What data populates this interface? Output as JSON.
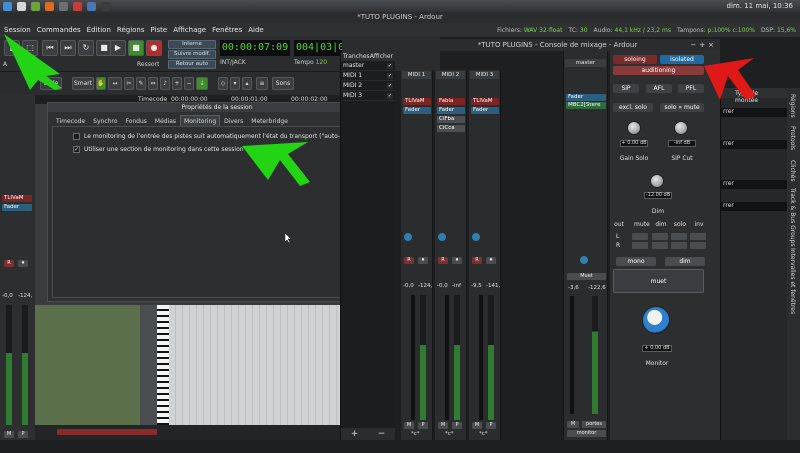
{
  "system": {
    "clock": "dim. 11 mai, 10:36"
  },
  "main_window": {
    "title": "*TUTO PLUGINS - Ardour"
  },
  "menubar": {
    "items": [
      "Session",
      "Commandes",
      "Édition",
      "Régions",
      "Piste",
      "Affichage",
      "Fenêtres",
      "Aide"
    ],
    "status": {
      "files_label": "Fichiers:",
      "files_value": "WAV 32-float",
      "tc_label": "TC:",
      "tc_value": "30",
      "audio_label": "Audio:",
      "audio_value": "44,1 kHz / 23,2 ms",
      "buffers_label": "Tampons:",
      "buffers_value": "p:100% c:100%",
      "dsp_label": "DSP:",
      "dsp_value": "15,6%"
    }
  },
  "transport": {
    "sync_buttons": [
      "Interne",
      "Suivre modif.",
      "Retour auto"
    ],
    "clock_primary": "00:00:07:09",
    "clock_secondary": "004|03|0",
    "source": "INT/JACK",
    "tempo_label": "Tempo",
    "tempo_value": "120",
    "auto_label": "A",
    "ressort_label": "Ressort"
  },
  "toolbar": {
    "slide": "Slide",
    "smart": "Smart",
    "sons": "Sons"
  },
  "timeline": {
    "timecode_label": "Timecode",
    "times": [
      "00:00:00:00",
      "00:00:01:00",
      "00:00:02:00"
    ]
  },
  "dialog": {
    "title": "Propriétés de la session",
    "tabs": [
      "Timecode",
      "Synchro",
      "Fondus",
      "Médias",
      "Monitoring",
      "Divers",
      "Meterbridge"
    ],
    "active_tab": "Monitoring",
    "options": [
      {
        "label": "Le monitoring de l'entrée des pistes suit automatiquement l'état du transport (\"auto-input\")",
        "checked": false
      },
      {
        "label": "Utiliser une section de monitoring dans cette session",
        "checked": true
      }
    ]
  },
  "tracks_panel": {
    "header_tracks": "Tranches",
    "header_show": "Afficher",
    "items": [
      "master",
      "MIDI 1",
      "MIDI 2",
      "MIDI 3"
    ],
    "add": "+",
    "remove": "−"
  },
  "mixer": {
    "title": "*TUTO PLUGINS - Console de mixage - Ardour",
    "strips": [
      {
        "name": "MIDI 1",
        "plugins": [
          "TLIVaM",
          "Fader"
        ],
        "gain": "-0,0",
        "peak": "-124,",
        "M": "M",
        "P": "P",
        "comment": "*c*"
      },
      {
        "name": "MIDI 2",
        "plugins": [
          "Fabla",
          "Fader",
          "CiFba",
          "CiCca"
        ],
        "gain": "-0,0",
        "peak": "-inf",
        "M": "M",
        "P": "P",
        "comment": "*c*"
      },
      {
        "name": "MIDI 3",
        "plugins": [
          "TLIVaM",
          "Fader"
        ],
        "gain": "-9,5",
        "peak": "-141,",
        "M": "M",
        "P": "P",
        "comment": "*c*"
      }
    ],
    "master": {
      "name": "master",
      "plugins": [
        "Fader",
        "MBC2[Stere"
      ],
      "gain": "-3,6",
      "peak": "-122,6",
      "muet": "Muet",
      "M": "M",
      "portes": "portes",
      "monitor": "monitor"
    }
  },
  "monitor_section": {
    "soloing": "soloing",
    "isolated": "isolated",
    "auditioning": "auditioning",
    "sip": "SiP",
    "afl": "AFL",
    "pfl": "PFL",
    "excl_solo": "excl. solo",
    "solo_mute": "solo » mute",
    "gain_solo": "Gain Solo",
    "gain_solo_value": "+ 0.00 dB",
    "sip_cut": "SiP Cut",
    "sip_cut_value": "-inf dB",
    "dim_value": "-12.00 dB",
    "dim": "Dim",
    "channel_headers": [
      "out",
      "mute",
      "dim",
      "solo",
      "inv"
    ],
    "channels": [
      "L",
      "R"
    ],
    "mono": "mono",
    "dim_btn": "dim",
    "muet": "muet",
    "monitor_value": "+ 0.00 dB",
    "monitor": "Monitor"
  },
  "right_panel": {
    "col1": "Regions",
    "col2": "Type de montée",
    "rows": [
      "rrer",
      "rrer",
      "rrer",
      "rrer"
    ],
    "vtabs": [
      "Régions",
      "Protools",
      "Clichés",
      "Track & Bus Groups",
      "Intervalles et fenêtres"
    ]
  },
  "colors": {
    "arrow_green": "#22d414",
    "arrow_red": "#e01818",
    "clock_green": "#52d636",
    "soloing": "#7a2a2a",
    "isolated": "#1f6aa0",
    "auditioning": "#8a3a3a"
  }
}
